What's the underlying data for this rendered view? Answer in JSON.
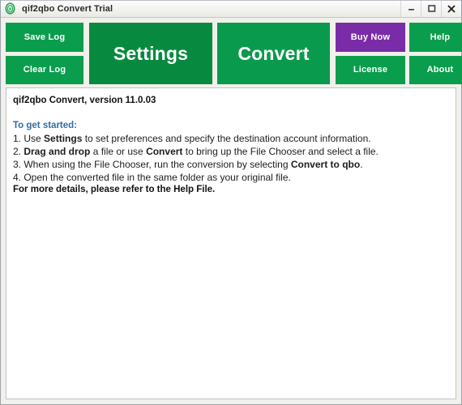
{
  "window": {
    "title": "qif2qbo Convert Trial",
    "app_icon": "fingerprint-icon",
    "controls": {
      "minimize": "minimize-icon",
      "maximize": "maximize-icon",
      "close": "close-icon"
    }
  },
  "colors": {
    "green_light": "#0a9d4d",
    "green_settings": "#078a40",
    "green_convert": "#0a9a4e",
    "purple": "#7a2ca8",
    "accent_blue": "#2f6da4",
    "window_bg": "#f1f0ea"
  },
  "toolbar": {
    "save_log": "Save Log",
    "clear_log": "Clear Log",
    "settings": "Settings",
    "convert": "Convert",
    "buy_now": "Buy Now",
    "license": "License",
    "help": "Help",
    "about": "About"
  },
  "log": {
    "version_line": "qif2qbo Convert, version 11.0.03",
    "get_started_heading": "To get started:",
    "steps": [
      {
        "number": "1. ",
        "pre": "Use ",
        "bold1": "Settings",
        "mid": " to set preferences and specify the destination account information.",
        "bold2": "",
        "post": ""
      },
      {
        "number": "2. ",
        "pre": "",
        "bold1": "Drag and drop",
        "mid": " a file or use ",
        "bold2": "Convert",
        "post": " to bring up the File Chooser and select a file."
      },
      {
        "number": "3. ",
        "pre": "When using the File Chooser, run the conversion by selecting ",
        "bold1": "Convert to qbo",
        "mid": ".",
        "bold2": "",
        "post": ""
      },
      {
        "number": "4. ",
        "pre": "Open the converted file in the same folder as your original file.",
        "bold1": "",
        "mid": "",
        "bold2": "",
        "post": ""
      }
    ],
    "footer_note": "For more details, please refer to the Help File."
  }
}
